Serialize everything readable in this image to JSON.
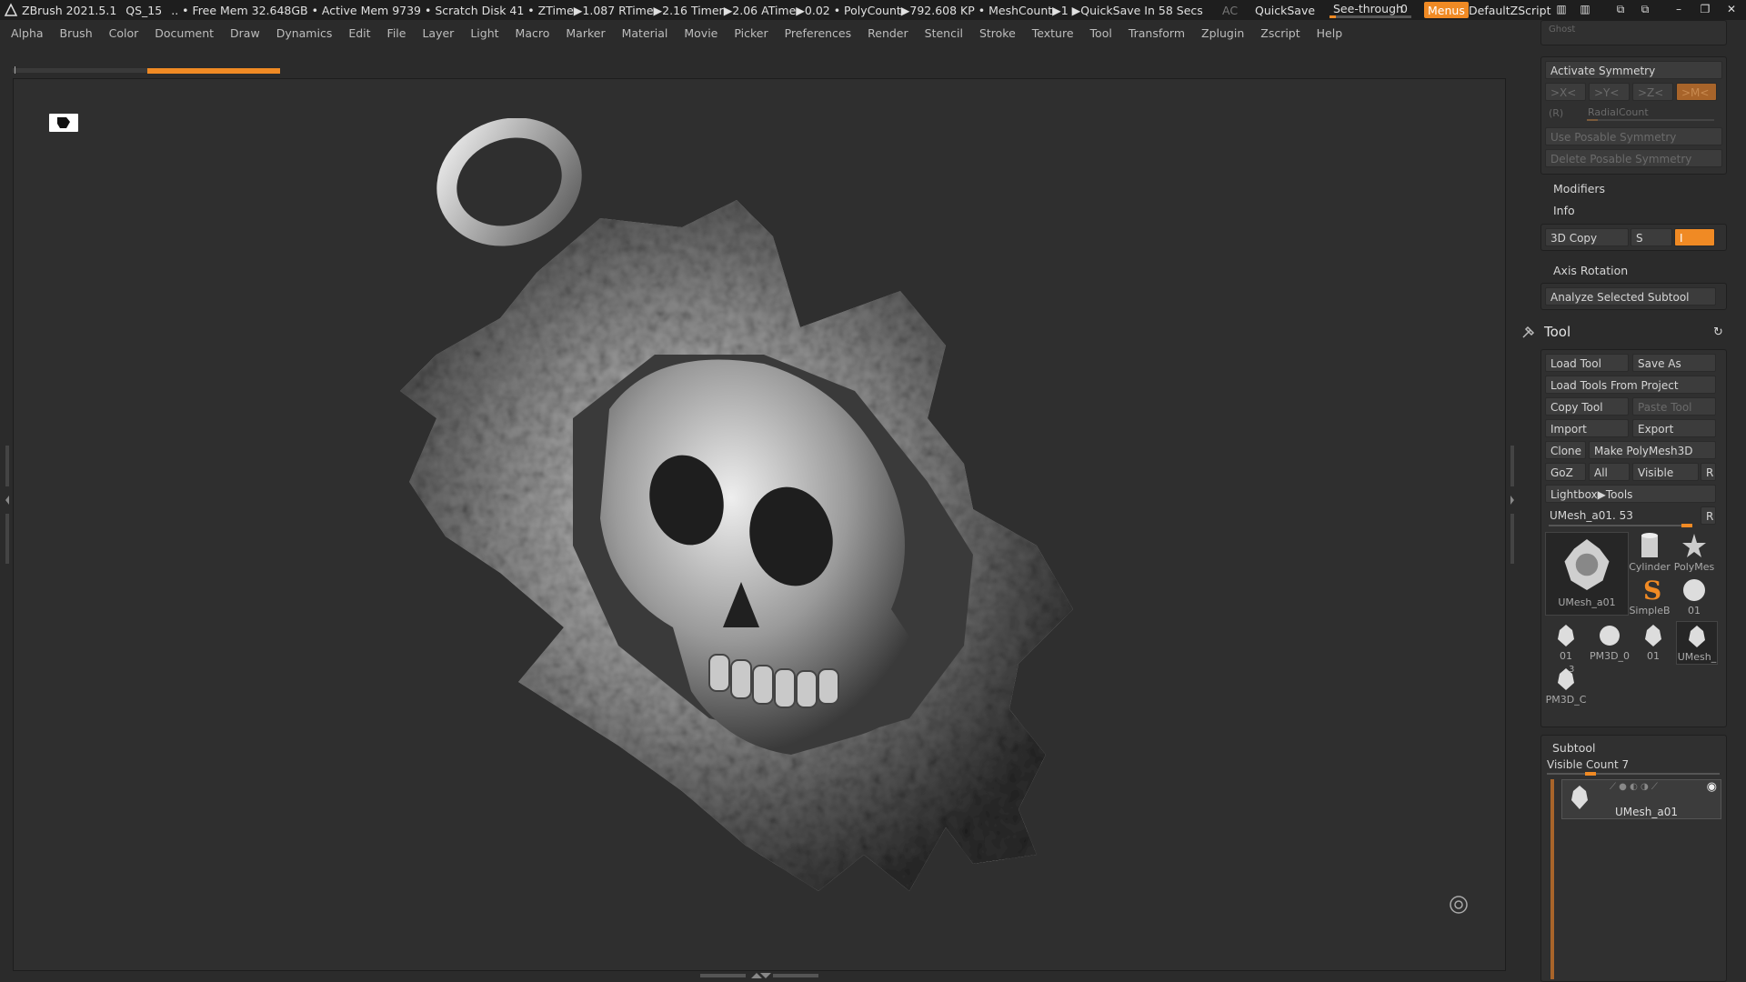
{
  "titlebar": {
    "app": "ZBrush 2021.5.1",
    "doc": "QS_15",
    "status": ".. • Free Mem 32.648GB • Active Mem 9739 • Scratch Disk 41 •  ZTime▶1.087 RTime▶2.16 Timer▶2.06 ATime▶0.02 • PolyCount▶792.608 KP  • MeshCount▶1  ▶QuickSave In 58 Secs",
    "ac": "AC",
    "quicksave": "QuickSave",
    "seethrough_label": "See-through",
    "seethrough_value": "0",
    "seethrough_level": 0.08,
    "menus": "Menus",
    "defaultzscript": "DefaultZScript"
  },
  "menubar": {
    "items": [
      "Alpha",
      "Brush",
      "Color",
      "Document",
      "Draw",
      "Dynamics",
      "Edit",
      "File",
      "Layer",
      "Light",
      "Macro",
      "Marker",
      "Material",
      "Movie",
      "Picker",
      "Preferences",
      "Render",
      "Stencil",
      "Stroke",
      "Texture",
      "Tool",
      "Transform",
      "Zplugin",
      "Zscript",
      "Help"
    ]
  },
  "canvas": {
    "progress": 0.5
  },
  "tray": {
    "ghost": "Ghost",
    "symmetry": {
      "title": "Activate Symmetry",
      "x": ">X<",
      "y": ">Y<",
      "z": ">Z<",
      "m": ">M<",
      "r": "(R)",
      "radial": "RadialCount",
      "use_posable": "Use Posable Symmetry",
      "delete_posable": "Delete Posable Symmetry"
    },
    "modifiers": "Modifiers",
    "info": "Info",
    "copy3d": "3D Copy",
    "copy3d_s": "S",
    "copy3d_i": "I",
    "axis_rotation": "Axis Rotation",
    "analyze": "Analyze Selected Subtool",
    "tool": {
      "title": "Tool",
      "load_tool": "Load Tool",
      "save_as": "Save As",
      "load_from_project": "Load Tools From Project",
      "copy_tool": "Copy Tool",
      "paste_tool": "Paste Tool",
      "import": "Import",
      "export": "Export",
      "clone": "Clone",
      "make_polymesh": "Make PolyMesh3D",
      "goz": "GoZ",
      "all": "All",
      "visible": "Visible",
      "r": "R",
      "lightbox": "Lightbox▶Tools",
      "current": "UMesh_a01. 53",
      "current_r": "R",
      "thumbs": [
        "UMesh_a01",
        "Cylinder",
        "PolyMes",
        "SimpleB",
        "01",
        "01",
        "PM3D_0",
        "01",
        "UMesh_",
        "PM3D_C"
      ],
      "thumb_badge": "3"
    },
    "subtool": {
      "title": "Subtool",
      "visible_count": "Visible Count 7",
      "item": "UMesh_a01"
    }
  },
  "colors": {
    "accent": "#f08a24",
    "bg": "#2b2b2b",
    "canvas": "#2f2f2f"
  }
}
